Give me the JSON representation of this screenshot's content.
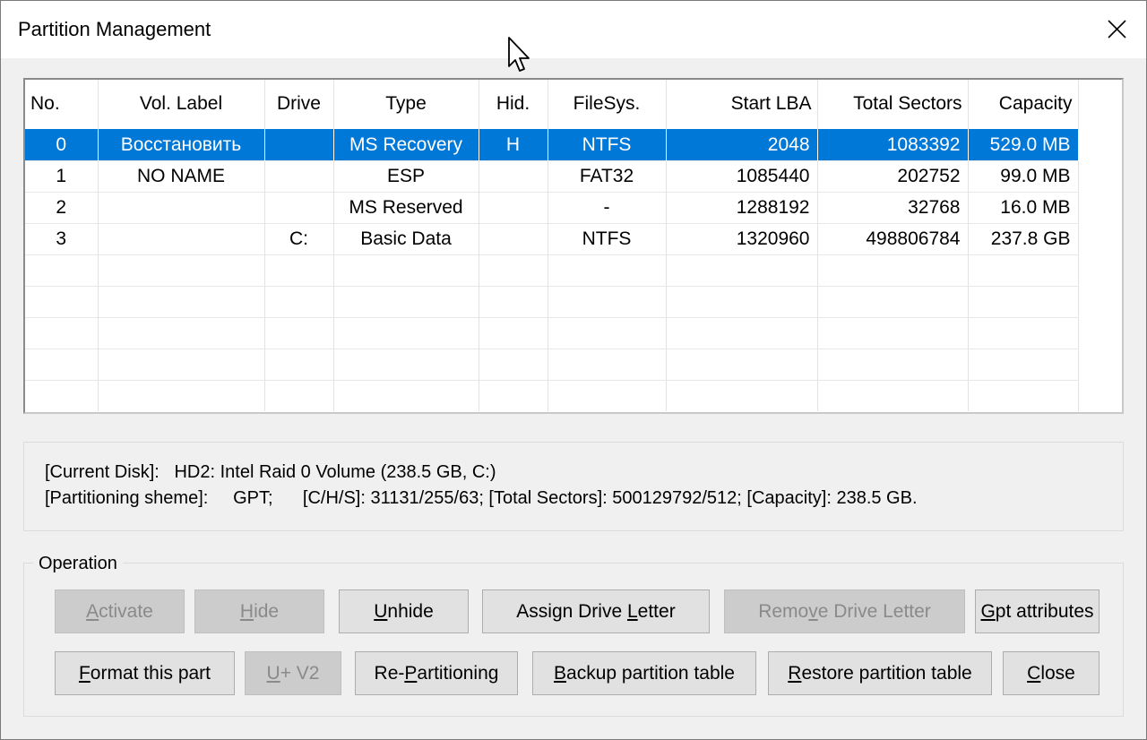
{
  "window": {
    "title": "Partition Management",
    "close_glyph": "✕"
  },
  "table": {
    "headers": [
      "No.",
      "Vol. Label",
      "Drive",
      "Type",
      "Hid.",
      "FileSys.",
      "Start LBA",
      "Total Sectors",
      "Capacity"
    ],
    "rows": [
      {
        "no": "0",
        "label": "Восстановить",
        "drive": "",
        "type": "MS Recovery",
        "hid": "H",
        "fs": "NTFS",
        "start": "2048",
        "sectors": "1083392",
        "capacity": "529.0 MB",
        "selected": true
      },
      {
        "no": "1",
        "label": "NO NAME",
        "drive": "",
        "type": "ESP",
        "hid": "",
        "fs": "FAT32",
        "start": "1085440",
        "sectors": "202752",
        "capacity": "99.0 MB",
        "selected": false
      },
      {
        "no": "2",
        "label": "",
        "drive": "",
        "type": "MS Reserved",
        "hid": "",
        "fs": "-",
        "start": "1288192",
        "sectors": "32768",
        "capacity": "16.0 MB",
        "selected": false
      },
      {
        "no": "3",
        "label": "",
        "drive": "C:",
        "type": "Basic Data",
        "hid": "",
        "fs": "NTFS",
        "start": "1320960",
        "sectors": "498806784",
        "capacity": "237.8 GB",
        "selected": false
      }
    ],
    "empty_rows": 5
  },
  "info": {
    "line1": "[Current Disk]:   HD2: Intel Raid 0 Volume (238.5 GB, C:)",
    "line2": "[Partitioning sheme]:     GPT;      [C/H/S]: 31131/255/63; [Total Sectors]: 500129792/512; [Capacity]: 238.5 GB."
  },
  "operation": {
    "label": "Operation",
    "buttons": {
      "activate": {
        "pre": "",
        "key": "A",
        "post": "ctivate",
        "disabled": true
      },
      "hide": {
        "pre": "",
        "key": "H",
        "post": "ide",
        "disabled": true
      },
      "unhide": {
        "pre": "",
        "key": "U",
        "post": "nhide",
        "disabled": false
      },
      "assign": {
        "pre": "Assign Drive ",
        "key": "L",
        "post": "etter",
        "disabled": false
      },
      "remove": {
        "pre": "Remo",
        "key": "v",
        "post": "e Drive Letter",
        "disabled": true
      },
      "gpt": {
        "pre": "",
        "key": "G",
        "post": "pt attributes",
        "disabled": false
      },
      "format": {
        "pre": "",
        "key": "F",
        "post": "ormat this part",
        "disabled": false
      },
      "uv2": {
        "pre": "",
        "key": "U",
        "post": "+ V2",
        "disabled": true
      },
      "repart": {
        "pre": "Re-",
        "key": "P",
        "post": "artitioning",
        "disabled": false
      },
      "backup": {
        "pre": "",
        "key": "B",
        "post": "ackup partition table",
        "disabled": false
      },
      "restore": {
        "pre": "",
        "key": "R",
        "post": "estore partition table",
        "disabled": false
      },
      "close": {
        "pre": "",
        "key": "C",
        "post": "lose",
        "disabled": false
      }
    }
  },
  "colors": {
    "selection": "#0078d7",
    "dialog_bg": "#f0f0f0",
    "disabled_text": "#8a8a8a"
  }
}
